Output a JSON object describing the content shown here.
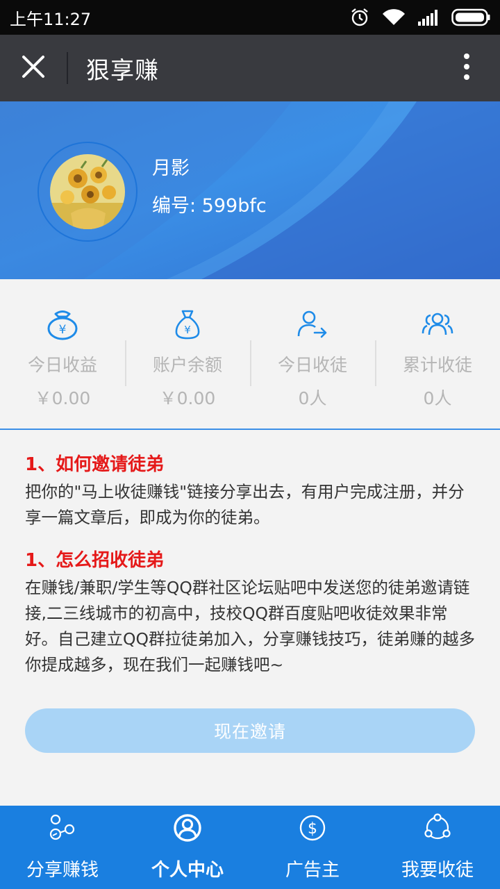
{
  "status_bar": {
    "time": "上午11:27",
    "icons": [
      "alarm-icon",
      "wifi-icon",
      "signal-icon",
      "battery-icon"
    ]
  },
  "title_bar": {
    "title": "狠享赚",
    "close_icon": "close-icon",
    "more_icon": "more-vertical-icon"
  },
  "profile": {
    "name": "月影",
    "id_text": "编号: 599bfc"
  },
  "stats": [
    {
      "icon": "money-bag-icon",
      "label": "今日收益",
      "value": "￥0.00"
    },
    {
      "icon": "money-pouch-icon",
      "label": "账户余额",
      "value": "￥0.00"
    },
    {
      "icon": "user-arrow-icon",
      "label": "今日收徒",
      "value": "0人"
    },
    {
      "icon": "users-group-icon",
      "label": "累计收徒",
      "value": "0人"
    }
  ],
  "sections": [
    {
      "title": "1、如何邀请徒弟",
      "body": "把你的\"马上收徒赚钱\"链接分享出去，有用户完成注册，并分享一篇文章后，即成为你的徒弟。"
    },
    {
      "title": "1、怎么招收徒弟",
      "body": "在赚钱/兼职/学生等QQ群社区论坛贴吧中发送您的徒弟邀请链接,二三线城市的初高中，技校QQ群百度贴吧收徒效果非常好。自己建立QQ群拉徒弟加入，分享赚钱技巧，徒弟赚的越多你提成越多，现在我们一起赚钱吧~"
    }
  ],
  "invite_button": "现在邀请",
  "bottom_nav": [
    {
      "icon": "share-molecule-icon",
      "label": "分享赚钱",
      "active": false
    },
    {
      "icon": "user-circle-icon",
      "label": "个人中心",
      "active": true
    },
    {
      "icon": "dollar-circle-icon",
      "label": "广告主",
      "active": false
    },
    {
      "icon": "network-icon",
      "label": "我要收徒",
      "active": false
    }
  ],
  "colors": {
    "status_bar": "#0a0a0a",
    "title_bar": "#393a3f",
    "banner": "#3b8fe6",
    "accent": "#3a8ee6",
    "section_title": "#e51919",
    "invite_button": "#a9d4f6",
    "bottom_nav": "#1a7fe0"
  }
}
